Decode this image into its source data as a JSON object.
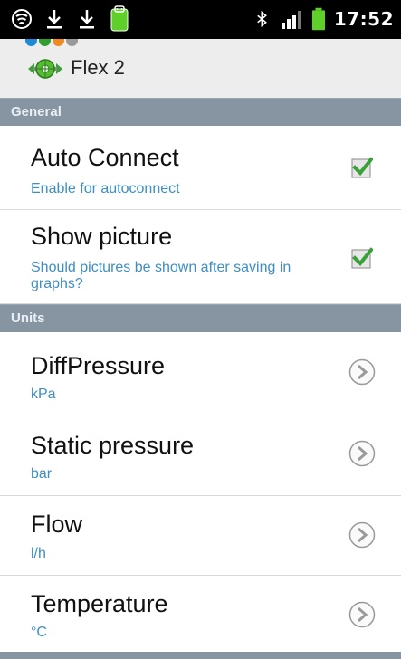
{
  "status_bar": {
    "time": "17:52",
    "icons": [
      "wifi-signal-icon",
      "download-icon",
      "download-icon",
      "android-debug-icon",
      "bluetooth-icon",
      "signal-bars-icon",
      "battery-icon"
    ]
  },
  "header": {
    "title": "Flex 2",
    "logo": "flex-logo-icon",
    "dot_colors": [
      "#1f8ad6",
      "#2f9e2f",
      "#f08a1e",
      "#999999"
    ]
  },
  "sections": [
    {
      "label": "General",
      "items": [
        {
          "title": "Auto Connect",
          "subtitle": "Enable for autoconnect",
          "control": "checkbox",
          "checked": true
        },
        {
          "title": "Show picture",
          "subtitle": "Should pictures be shown after saving in graphs?",
          "control": "checkbox",
          "checked": true
        }
      ]
    },
    {
      "label": "Units",
      "items": [
        {
          "title": "DiffPressure",
          "subtitle": "kPa",
          "control": "chevron-right-icon"
        },
        {
          "title": "Static pressure",
          "subtitle": "bar",
          "control": "chevron-right-icon"
        },
        {
          "title": "Flow",
          "subtitle": "l/h",
          "control": "chevron-right-icon"
        },
        {
          "title": "Temperature",
          "subtitle": "°C",
          "control": "chevron-right-icon"
        }
      ]
    }
  ],
  "colors": {
    "section_header_bg": "#8795a3",
    "subtitle": "#3e8ec2",
    "check": "#3aa13a"
  }
}
